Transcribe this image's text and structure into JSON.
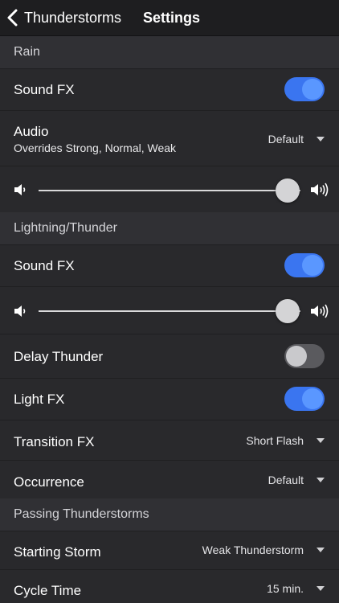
{
  "nav": {
    "back_label": "Thunderstorms",
    "title": "Settings"
  },
  "sections": {
    "rain": "Rain",
    "lightning": "Lightning/Thunder",
    "passing": "Passing Thunderstorms"
  },
  "rain": {
    "sound_fx": {
      "label": "Sound FX",
      "on": true
    },
    "audio": {
      "label": "Audio",
      "sub": "Overrides Strong, Normal, Weak",
      "value": "Default"
    },
    "volume_level": 0.95
  },
  "lightning": {
    "sound_fx": {
      "label": "Sound FX",
      "on": true
    },
    "volume_level": 0.95,
    "delay_thunder": {
      "label": "Delay Thunder",
      "on": false
    },
    "light_fx": {
      "label": "Light FX",
      "on": true
    },
    "transition_fx": {
      "label": "Transition FX",
      "value": "Short Flash"
    },
    "occurrence": {
      "label": "Occurrence",
      "value": "Default"
    }
  },
  "passing": {
    "starting_storm": {
      "label": "Starting Storm",
      "value": "Weak Thunderstorm"
    },
    "cycle_time": {
      "label": "Cycle Time",
      "value": "15 min."
    }
  },
  "colors": {
    "background": "#1c1c1e",
    "row": "#29292c",
    "section": "#303034",
    "toggle_on": "#3a75f0",
    "toggle_off": "#5a5a5e"
  }
}
